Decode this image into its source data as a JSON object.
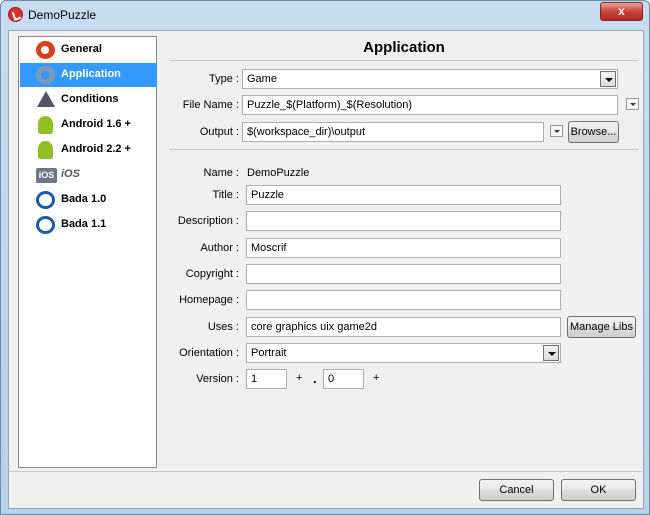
{
  "window": {
    "title": "DemoPuzzle",
    "close_label": "x"
  },
  "sidebar": {
    "items": [
      {
        "label": "General",
        "icon": "gear-icon"
      },
      {
        "label": "Application",
        "icon": "application-gear-icon",
        "selected": true
      },
      {
        "label": "Conditions",
        "icon": "warning-icon"
      },
      {
        "label": "Android 1.6 +",
        "icon": "android-icon"
      },
      {
        "label": "Android 2.2 +",
        "icon": "android-icon"
      },
      {
        "label": "iOS",
        "icon": "ios-icon"
      },
      {
        "label": "Bada 1.0",
        "icon": "bada-icon"
      },
      {
        "label": "Bada 1.1",
        "icon": "bada-icon"
      }
    ],
    "ios_badge": "iOS"
  },
  "main": {
    "title": "Application",
    "type": {
      "label": "Type :",
      "value": "Game"
    },
    "file_name": {
      "label": "File Name :",
      "value": "Puzzle_$(Platform)_$(Resolution)"
    },
    "output": {
      "label": "Output :",
      "value": "$(workspace_dir)\\output",
      "browse_label": "Browse..."
    },
    "name": {
      "label": "Name :",
      "value": "DemoPuzzle"
    },
    "title_field": {
      "label": "Title :",
      "value": "Puzzle"
    },
    "description": {
      "label": "Description :",
      "value": ""
    },
    "author": {
      "label": "Author :",
      "value": "Moscrif"
    },
    "copyright": {
      "label": "Copyright :",
      "value": ""
    },
    "homepage": {
      "label": "Homepage :",
      "value": ""
    },
    "uses": {
      "label": "Uses :",
      "value": "core graphics uix game2d",
      "manage_label": "Manage Libs"
    },
    "orientation": {
      "label": "Orientation :",
      "value": "Portrait"
    },
    "version": {
      "label": "Version :",
      "major": "1",
      "minor": "0",
      "plus": "+",
      "dot": "."
    }
  },
  "footer": {
    "cancel_label": "Cancel",
    "ok_label": "OK"
  }
}
